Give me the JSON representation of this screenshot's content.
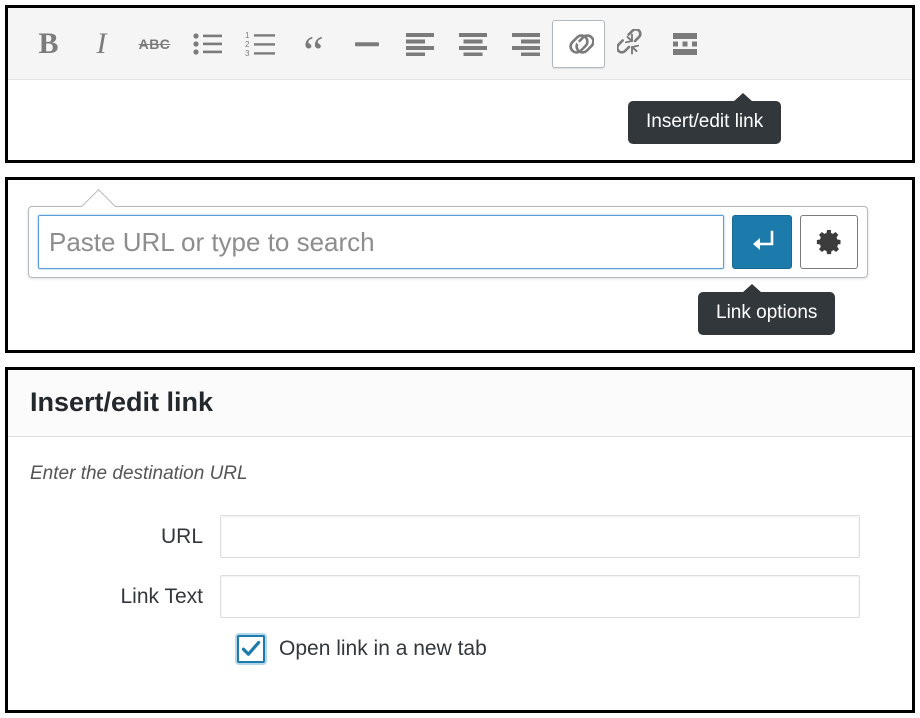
{
  "editor_toolbar": {
    "buttons": [
      {
        "name": "bold",
        "icon": "bold-icon",
        "glyph": "B",
        "active": false
      },
      {
        "name": "italic",
        "icon": "italic-icon",
        "glyph": "I",
        "active": false
      },
      {
        "name": "strikethrough",
        "icon": "strikethrough-icon",
        "glyph": "ABC",
        "active": false
      },
      {
        "name": "bullet-list",
        "icon": "bulleted-list-icon",
        "glyph": "",
        "active": false
      },
      {
        "name": "numbered-list",
        "icon": "numbered-list-icon",
        "glyph": "",
        "active": false
      },
      {
        "name": "blockquote",
        "icon": "blockquote-icon",
        "glyph": "“",
        "active": false
      },
      {
        "name": "horizontal-rule",
        "icon": "horizontal-rule-icon",
        "glyph": "",
        "active": false
      },
      {
        "name": "align-left",
        "icon": "align-left-icon",
        "glyph": "",
        "active": false
      },
      {
        "name": "align-center",
        "icon": "align-center-icon",
        "glyph": "",
        "active": false
      },
      {
        "name": "align-right",
        "icon": "align-right-icon",
        "glyph": "",
        "active": false
      },
      {
        "name": "insert-link",
        "icon": "link-icon",
        "glyph": "",
        "active": true
      },
      {
        "name": "remove-link",
        "icon": "unlink-icon",
        "glyph": "",
        "active": false
      },
      {
        "name": "read-more",
        "icon": "read-more-icon",
        "glyph": "",
        "active": false
      }
    ],
    "tooltip": "Insert/edit link"
  },
  "inline_link_toolbar": {
    "url_placeholder": "Paste URL or type to search",
    "url_value": "",
    "submit_icon": "enter-arrow-icon",
    "options_icon": "gear-icon",
    "tooltip": "Link options"
  },
  "link_modal": {
    "title": "Insert/edit link",
    "hint": "Enter the destination URL",
    "fields": [
      {
        "label": "URL",
        "value": "",
        "placeholder": ""
      },
      {
        "label": "Link Text",
        "value": "",
        "placeholder": ""
      }
    ],
    "checkbox": {
      "label": "Open link in a new tab",
      "checked": true
    }
  },
  "colors": {
    "accent_blue": "#1c7bab",
    "focus_blue": "#5b9dd9",
    "tooltip_bg": "#32373c",
    "toolbar_bg": "#f5f5f5",
    "icon_gray": "#7b7b7b"
  }
}
